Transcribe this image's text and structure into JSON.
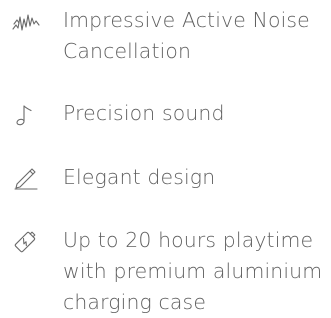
{
  "features": [
    {
      "icon": "sound-wave-icon",
      "lines": [
        "Impressive Active Noise",
        "Cancellation"
      ]
    },
    {
      "icon": "music-note-icon",
      "lines": [
        "Precision sound"
      ]
    },
    {
      "icon": "pencil-icon",
      "lines": [
        "Elegant design"
      ]
    },
    {
      "icon": "battery-charging-icon",
      "lines": [
        "Up to 20 hours playtime",
        "with premium aluminium",
        "charging case"
      ]
    }
  ],
  "colors": {
    "text": "#5f5f5f",
    "icon": "#6a6a6a",
    "background": "#ffffff"
  }
}
